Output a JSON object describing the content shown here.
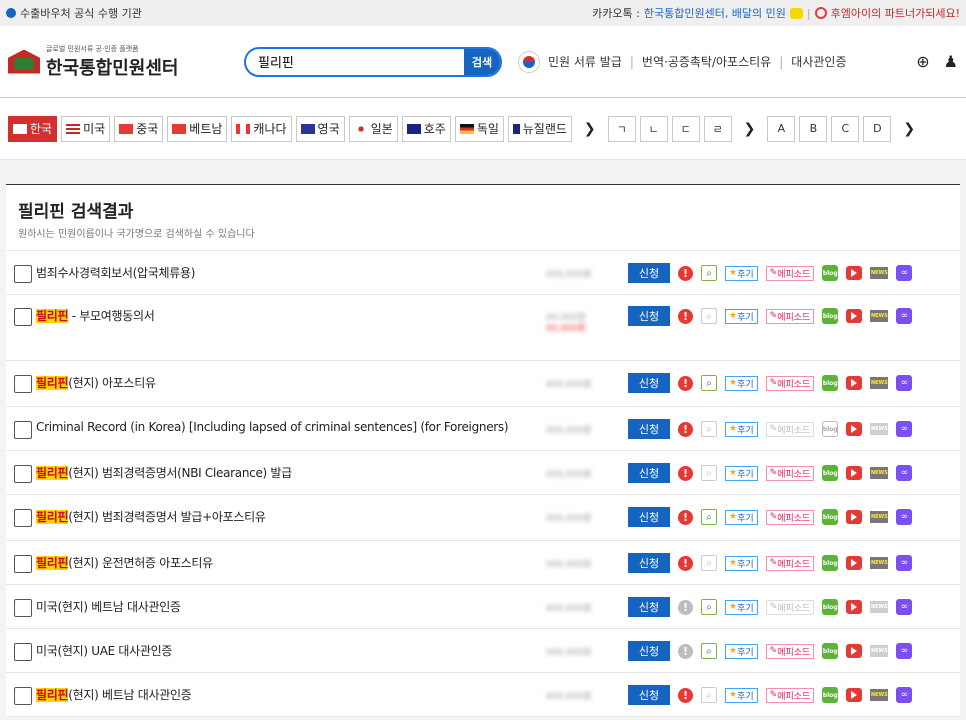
{
  "topbar": {
    "left_text": "수출바우처 공식 수행 기관",
    "kakao_label": "카카오톡 : ",
    "kakao_text": "한국통합민원센터, 배달의 민원",
    "partner_text": "후엠아이의 파트너가되세요!"
  },
  "header": {
    "logo_small": "글로벌 민원서류 공·인증 플랫폼",
    "logo_big": "한국통합민원센터",
    "search_value": "필리핀",
    "search_button": "검색",
    "nav": [
      "민원 서류 발급",
      "번역·공증촉탁/아포스티유",
      "대사관인증"
    ]
  },
  "flags": [
    {
      "label": "한국",
      "active": true
    },
    {
      "label": "미국"
    },
    {
      "label": "중국"
    },
    {
      "label": "베트남"
    },
    {
      "label": "캐나다"
    },
    {
      "label": "영국"
    },
    {
      "label": "일본"
    },
    {
      "label": "호주"
    },
    {
      "label": "독일"
    },
    {
      "label": "뉴질랜드"
    }
  ],
  "consonants": [
    "ㄱ",
    "ㄴ",
    "ㄷ",
    "ㄹ"
  ],
  "letters": [
    "A",
    "B",
    "C",
    "D"
  ],
  "results": {
    "title": "필리핀 검색결과",
    "subtitle": "원하시는 민원이름이나 국가명으로 검색하실 수 있습니다",
    "apply_label": "신청",
    "review_label": "후기",
    "epi_label": "에피소드",
    "rows": [
      {
        "hl": "",
        "text": "범죄수사경력회보서(압국체류용)",
        "price": "000,000원"
      },
      {
        "hl": "필리핀",
        "text": " - 부모여행동의서",
        "price": "00,000원",
        "price2": "00,000원"
      },
      {
        "hl": "필리핀",
        "text": "(현지) 아포스티유",
        "price": "000,000원"
      },
      {
        "hl": "",
        "text": "Criminal Record (in Korea) [Including lapsed of criminal sentences] (for Foreigners)",
        "price": "000,000원"
      },
      {
        "hl": "필리핀",
        "text": "(현지) 범죄경력증명서(NBI Clearance) 발급",
        "price": "000,000원"
      },
      {
        "hl": "필리핀",
        "text": "(현지) 범죄경력증명서 발급+아포스티유",
        "price": "000,000원"
      },
      {
        "hl": "필리핀",
        "text": "(현지) 운전면허증 아포스티유",
        "price": "000,000원"
      },
      {
        "hl": "",
        "text": "미국(현지) 베트남 대사관인증",
        "price": "000,000원"
      },
      {
        "hl": "",
        "text": "미국(현지) UAE 대사관인증",
        "price": "000,000원"
      },
      {
        "hl": "필리핀",
        "text": "(현지) 베트남 대사관인증",
        "price": "000,000원"
      }
    ]
  }
}
